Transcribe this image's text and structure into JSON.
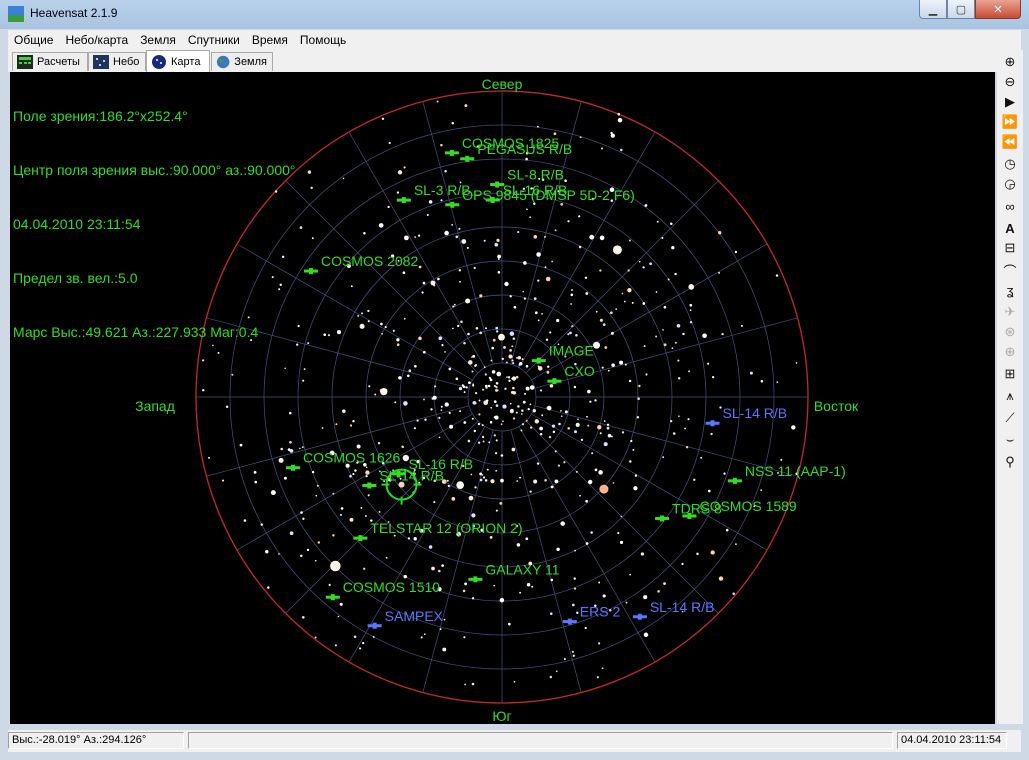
{
  "window": {
    "title": "Heavensat 2.1.9"
  },
  "menu": [
    "Общие",
    "Небо/карта",
    "Земля",
    "Спутники",
    "Время",
    "Помощь"
  ],
  "tabs": [
    "Расчеты",
    "Небо",
    "Карта",
    "Земля"
  ],
  "active_tab": "Карта",
  "info": {
    "fov": "Поле зрения:186.2°x252.4°",
    "center": "Центр поля зрения выс.:90.000° аз.:90.000°",
    "datetime": "04.04.2010 23:11:54",
    "limit": "Предел зв. вел.:5.0",
    "mars": "Марс Выс.:49.621 Аз.:227.933 Маг:0.4"
  },
  "directions": {
    "north": "Север",
    "south": "Юг",
    "east": "Восток",
    "west": "Запад"
  },
  "colors": {
    "label_green": "#33dd22",
    "horizon": "#c0282e",
    "grid": "#4a5080",
    "sat_blue": "#5a78ff"
  },
  "satellites": [
    {
      "name": "COSMOS 1825",
      "az": 11.6,
      "alt": 16.7,
      "color": "green"
    },
    {
      "name": "PEGASUS R/B",
      "az": 8.3,
      "alt": 19.2,
      "color": "green"
    },
    {
      "name": "SL-8 R/B",
      "az": 1.3,
      "alt": 27.5,
      "color": "green"
    },
    {
      "name": "SL-3 R/B",
      "az": 26.5,
      "alt": 25.3,
      "color": "green"
    },
    {
      "name": "OPS 9845 (DMSP 5D-2 F6)",
      "az": 14.5,
      "alt": 31.6,
      "color": "green"
    },
    {
      "name": "SL-16 R/B",
      "az": 2.7,
      "alt": 32.0,
      "color": "green"
    },
    {
      "name": "COSMOS 2082",
      "az": 56.6,
      "alt": 22.7,
      "color": "green"
    },
    {
      "name": "IMAGE",
      "az": 314.7,
      "alt": 74.8,
      "color": "green"
    },
    {
      "name": "CXO",
      "az": 286.8,
      "alt": 73.9,
      "color": "green"
    },
    {
      "name": "SL-14 R/B",
      "az": 262.9,
      "alt": 27.6,
      "color": "blue"
    },
    {
      "name": "NSS 11 (AAP-1)",
      "az": 250.2,
      "alt": 17.2,
      "color": "green"
    },
    {
      "name": "COSMOS 1589",
      "az": 237.6,
      "alt": 24.7,
      "color": "green"
    },
    {
      "name": "TDRS 8",
      "az": 232.8,
      "alt": 30.9,
      "color": "green"
    },
    {
      "name": "COSMOS 1626",
      "az": 108.7,
      "alt": 25.1,
      "color": "green"
    },
    {
      "name": "SL-14 R/B",
      "az": 123.7,
      "alt": 43.1,
      "color": "green"
    },
    {
      "name": "SL-16 R/B",
      "az": 126.6,
      "alt": 52.1,
      "color": "green"
    },
    {
      "name": "TELSTAR 12 (ORION 2)",
      "az": 134.9,
      "alt": 31.2,
      "color": "green"
    },
    {
      "name": "GALAXY 11",
      "az": 171.7,
      "alt": 35.8,
      "color": "green"
    },
    {
      "name": "COSMOS 1510",
      "az": 139.8,
      "alt": 12.9,
      "color": "green"
    },
    {
      "name": "ERS 2",
      "az": 196.8,
      "alt": 21.0,
      "color": "blue"
    },
    {
      "name": "SAMPEX",
      "az": 150.9,
      "alt": 13.0,
      "color": "blue"
    },
    {
      "name": "SL-14 R/B",
      "az": 212.1,
      "alt": 13.7,
      "color": "blue"
    }
  ],
  "stars": [
    {
      "az": 19.7,
      "alt": 60.0,
      "mag": 1.8
    },
    {
      "az": 13.8,
      "alt": 42.9,
      "mag": 1.9
    },
    {
      "az": 31.2,
      "alt": 50.8,
      "mag": 1.9
    },
    {
      "az": 0.5,
      "alt": 72.4,
      "mag": 1.0
    },
    {
      "az": 250.2,
      "alt": 56.4,
      "mag": 2.5
    },
    {
      "az": 298.7,
      "alt": 58.3,
      "mag": 0.9
    },
    {
      "az": 232.6,
      "alt": 53.5,
      "mag": 2.0
    },
    {
      "az": 201.4,
      "alt": 63.3,
      "mag": 2.3
    },
    {
      "az": 154.6,
      "alt": 61.3,
      "mag": 0.6
    },
    {
      "az": 135.4,
      "alt": 20.2,
      "mag": -0.7
    },
    {
      "az": 112.7,
      "alt": 17.1,
      "mag": 1.8
    },
    {
      "az": 106.0,
      "alt": 22.4,
      "mag": 1.8
    },
    {
      "az": 87.4,
      "alt": 55.2,
      "mag": 0.8
    },
    {
      "az": 63.2,
      "alt": 43.9,
      "mag": 1.8
    },
    {
      "az": 68.3,
      "alt": 38.4,
      "mag": 2.2
    },
    {
      "az": 330.7,
      "alt": 36.1,
      "mag": 1.9
    },
    {
      "az": 350.3,
      "alt": 50.0,
      "mag": 2.5
    },
    {
      "az": 300.2,
      "alt": 25.6,
      "mag": 1.5
    },
    {
      "az": 321.9,
      "alt": 35.0,
      "mag": 0.0
    },
    {
      "az": 286.0,
      "alt": 56.0,
      "mag": 2.8
    },
    {
      "az": 122.4,
      "alt": 56.5,
      "mag": 1.2
    },
    {
      "az": 180.0,
      "alt": 65.4,
      "mag": 2.4
    },
    {
      "az": 31.0,
      "alt": 35.4,
      "mag": 1.9
    },
    {
      "az": 20.1,
      "alt": 28.9,
      "mag": 2.7
    },
    {
      "az": 95.1,
      "alt": 43.3,
      "mag": 2.5
    },
    {
      "az": 205.6,
      "alt": 48.7,
      "mag": 2.0
    },
    {
      "az": 151.7,
      "alt": 30.0,
      "mag": 2.5
    },
    {
      "az": 126.4,
      "alt": 49.0,
      "mag": 2.5
    },
    {
      "az": 116.3,
      "alt": 45.0,
      "mag": 2.5
    },
    {
      "az": 114.0,
      "alt": 40.3,
      "mag": 2.2
    }
  ],
  "mars": {
    "az": 227.9,
    "alt": 49.6
  },
  "selection": {
    "az": 131.1,
    "alt": 50.8
  },
  "status": {
    "position": "Выс.:-28.019° Аз.:294.126°",
    "middle": "",
    "datetime": "04.04.2010 23:11:54"
  },
  "toolbar_icons": [
    "zoom-in-icon",
    "zoom-out-icon",
    "play-icon",
    "fast-forward-icon",
    "fast-rewind-icon",
    "clock-icon",
    "clock-reset-icon",
    "binoculars-icon",
    "text-label-icon",
    "lock-icon",
    "horizon-arc-icon",
    "trail-icon",
    "satellite-icon",
    "grid-sphere-icon",
    "globe-grid-icon",
    "constellation-icon",
    "tower-icon",
    "line-tool-icon",
    "horizon-icon",
    "telescope-icon"
  ]
}
